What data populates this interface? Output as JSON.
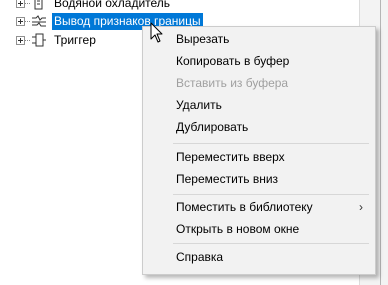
{
  "tree": {
    "items": [
      {
        "label": "Водяной охладитель",
        "icon": "water-cooler-icon",
        "selected": false
      },
      {
        "label": "Вывод признаков границы",
        "icon": "boundary-signal-icon",
        "selected": true
      },
      {
        "label": "Триггер",
        "icon": "trigger-icon",
        "selected": false
      }
    ]
  },
  "context_menu": {
    "cut": "Вырезать",
    "copy": "Копировать в буфер",
    "paste": "Вставить из буфера",
    "delete": "Удалить",
    "duplicate": "Дублировать",
    "move_up": "Переместить вверх",
    "move_down": "Переместить вниз",
    "place_in_library": "Поместить в библиотеку",
    "open_new_window": "Открыть в новом окне",
    "help": "Справка",
    "submenu_arrow": "›"
  },
  "colors": {
    "selection": "#0078d7",
    "menu_background": "#f2f2f2",
    "disabled_text": "#a0a0a0"
  }
}
